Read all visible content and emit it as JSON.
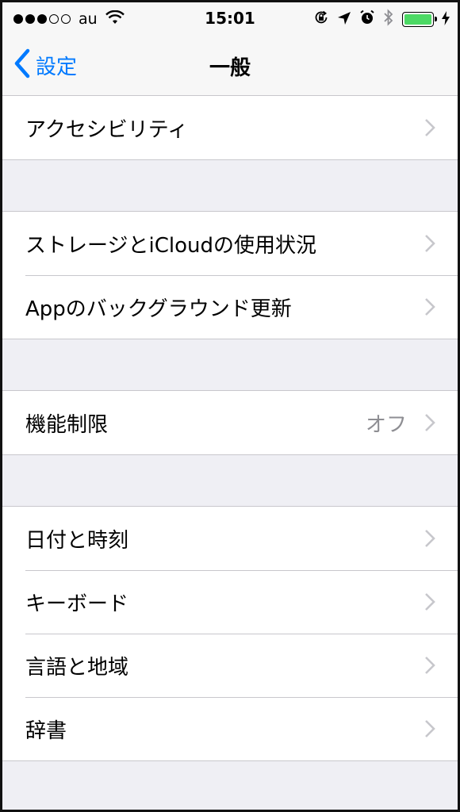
{
  "status_bar": {
    "carrier": "au",
    "time": "15:01",
    "signal_filled": 3,
    "signal_total": 5,
    "battery_level": 1.0,
    "battery_color": "#4cd964"
  },
  "nav": {
    "back_label": "設定",
    "title": "一般",
    "accent": "#007aff"
  },
  "groups": [
    {
      "rows": [
        {
          "label": "アクセシビリティ"
        }
      ]
    },
    {
      "rows": [
        {
          "label": "ストレージとiCloudの使用状況"
        },
        {
          "label": "Appのバックグラウンド更新"
        }
      ]
    },
    {
      "rows": [
        {
          "label": "機能制限",
          "value": "オフ"
        }
      ]
    },
    {
      "rows": [
        {
          "label": "日付と時刻"
        },
        {
          "label": "キーボード"
        },
        {
          "label": "言語と地域"
        },
        {
          "label": "辞書"
        }
      ]
    }
  ]
}
